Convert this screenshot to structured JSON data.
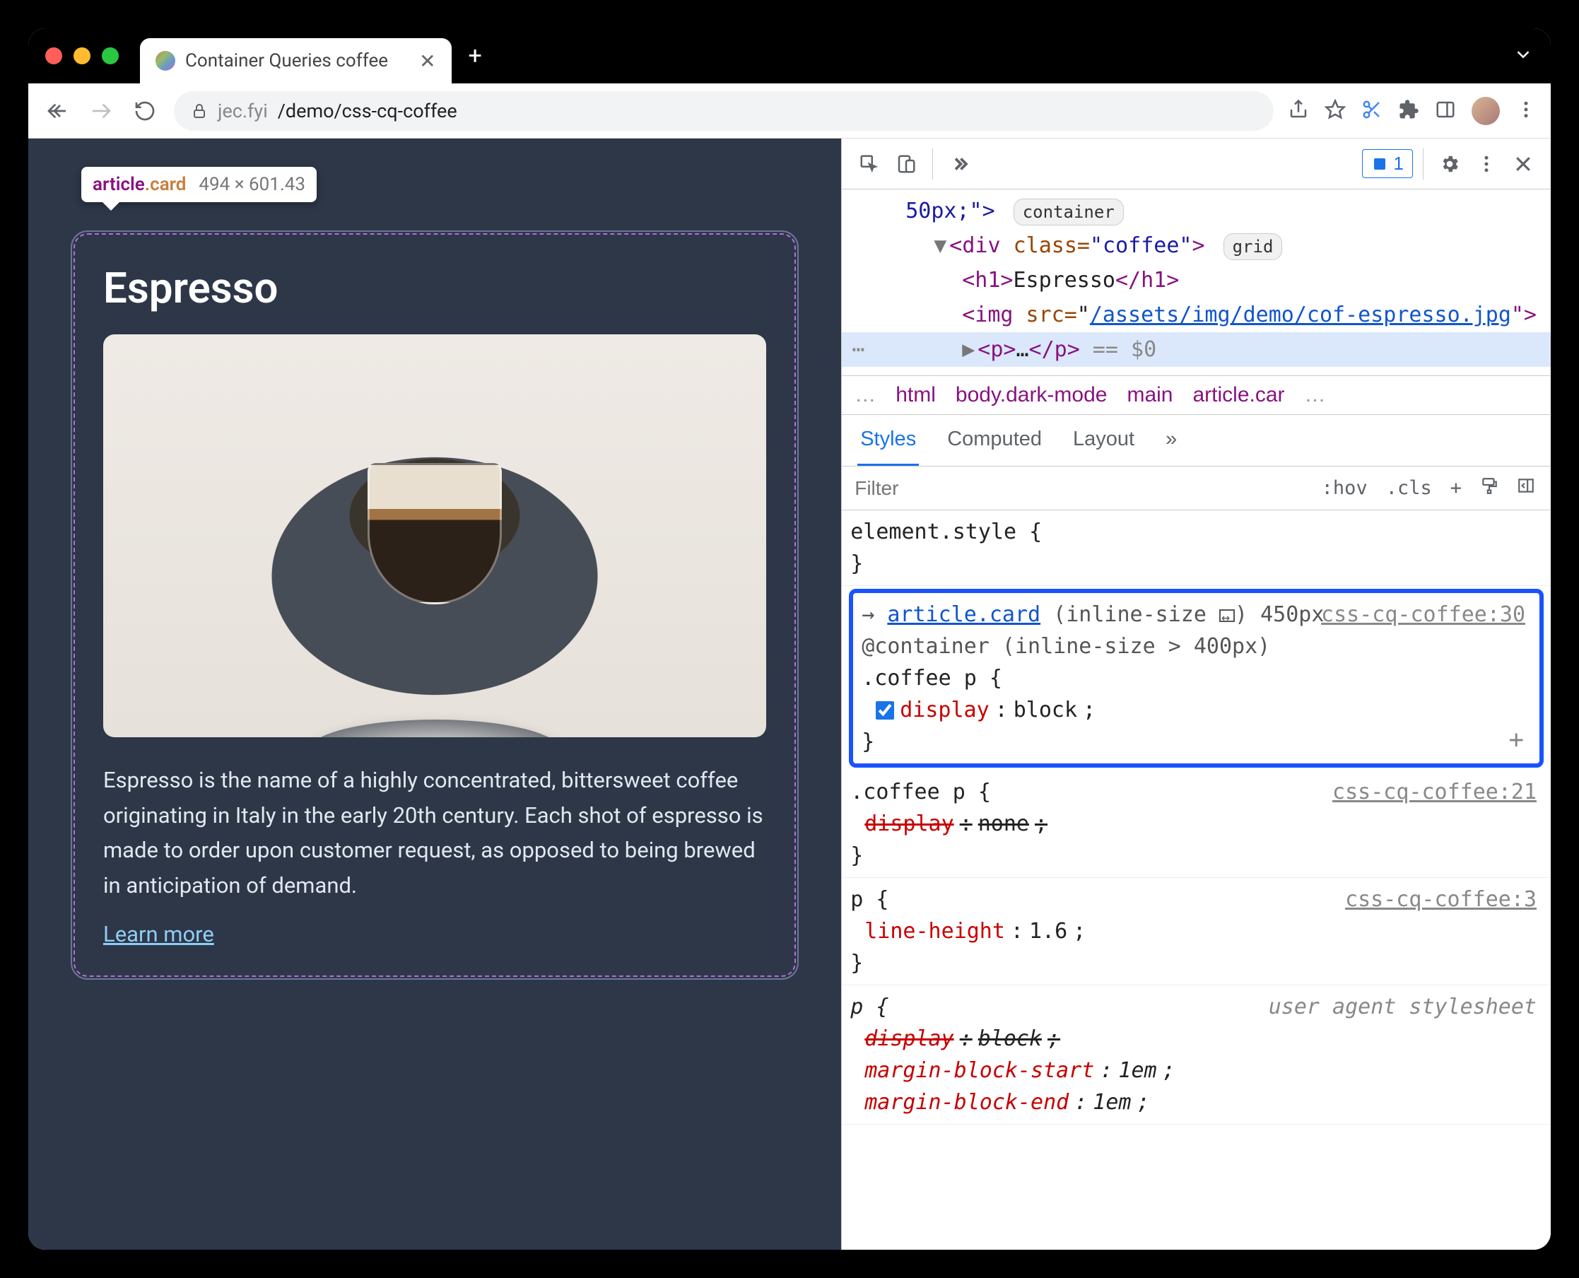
{
  "browser": {
    "tab_title": "Container Queries coffee",
    "url_host": "jec.fyi",
    "url_path": "/demo/css-cq-coffee"
  },
  "inspect_tooltip": {
    "element": "article",
    "class": ".card",
    "dimensions": "494 × 601.43"
  },
  "page_content": {
    "heading": "Espresso",
    "paragraph": "Espresso is the name of a highly concentrated, bittersweet coffee originating in Italy in the early 20th century. Each shot of espresso is made to order upon customer request, as opposed to being brewed in anticipation of demand.",
    "link_text": "Learn more"
  },
  "elements_panel": {
    "line0_style": "50px;\">",
    "line0_badge": "container",
    "line1_tr": "▼",
    "line1_tag_open": "<div ",
    "line1_attr_name": "class=",
    "line1_attr_val": "\"coffee\"",
    "line1_tag_close": ">",
    "line1_badge": "grid",
    "line2": "<h1>Espresso</h1>",
    "line3_open": "<img ",
    "line3_attr": "src=",
    "line3_url": "/assets/img/demo/cof-espresso.jpg",
    "line3_close": "\">",
    "line4_tr": "▶",
    "line4": "<p>…</p>",
    "line4_suffix": " == $0"
  },
  "breadcrumbs": [
    "…",
    "html",
    "body.dark-mode",
    "main",
    "article.car",
    "…"
  ],
  "styles_tabs": [
    "Styles",
    "Computed",
    "Layout",
    "»"
  ],
  "styles_toolbar": {
    "filter_placeholder": "Filter",
    "hov": ":hov",
    "cls": ".cls"
  },
  "issue_count": "1",
  "rule0": {
    "selector": "element.style"
  },
  "rule1": {
    "cq_arrow": "→",
    "cq_selector": "article.card",
    "cq_dim": "(inline-size",
    "cq_val": ") 450px",
    "cq_at": "@container",
    "cq_cond": "(inline-size > 400px)",
    "selector": ".coffee p",
    "src": "css-cq-coffee:30",
    "prop": "display",
    "val": "block"
  },
  "rule2": {
    "selector": ".coffee p",
    "src": "css-cq-coffee:21",
    "prop": "display",
    "val": "none"
  },
  "rule3": {
    "selector": "p",
    "src": "css-cq-coffee:3",
    "prop": "line-height",
    "val": "1.6"
  },
  "rule4": {
    "selector": "p",
    "src": "user agent stylesheet",
    "p1": "display",
    "v1": "block",
    "p2": "margin-block-start",
    "v2": "1em",
    "p3": "margin-block-end",
    "v3": "1em"
  }
}
